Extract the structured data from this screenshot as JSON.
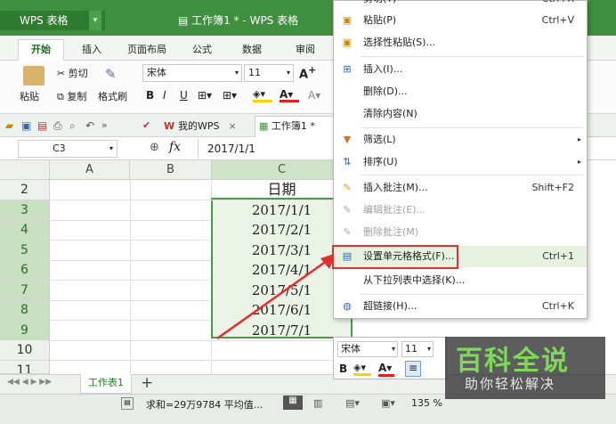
{
  "app": {
    "name": "WPS 表格",
    "window_title": "工作簿1 * - WPS 表格"
  },
  "ribbon_tabs": [
    "开始",
    "插入",
    "页面布局",
    "公式",
    "数据",
    "审阅"
  ],
  "clipboard": {
    "cut": "剪切",
    "paste": "粘贴",
    "copy": "复制",
    "format_painter": "格式刷"
  },
  "font": {
    "name": "宋体",
    "size": "11",
    "bold": "B",
    "italic": "I",
    "underline": "U"
  },
  "quickbar": {
    "tab_mywps": "我的WPS",
    "tab_book": "工作簿1 *"
  },
  "formula": {
    "cell_ref": "C3",
    "fx": "fx",
    "value": "2017/1/1"
  },
  "columns": [
    "A",
    "B",
    "C"
  ],
  "rows": [
    {
      "num": "2",
      "c": "日期"
    },
    {
      "num": "3",
      "c": "2017/1/1"
    },
    {
      "num": "4",
      "c": "2017/2/1"
    },
    {
      "num": "5",
      "c": "2017/3/1"
    },
    {
      "num": "6",
      "c": "2017/4/1"
    },
    {
      "num": "7",
      "c": "2017/5/1"
    },
    {
      "num": "8",
      "c": "2017/6/1"
    },
    {
      "num": "9",
      "c": "2017/7/1"
    },
    {
      "num": "10",
      "c": ""
    },
    {
      "num": "11",
      "c": ""
    }
  ],
  "sheet": {
    "name": "工作表1",
    "add": "+"
  },
  "status": {
    "summary": "求和=29万9784 平均值...",
    "zoom": "135 %"
  },
  "context_menu": {
    "cut": {
      "label": "剪切(T)",
      "shortcut": "Ctrl+X"
    },
    "paste": {
      "label": "粘贴(P)",
      "shortcut": "Ctrl+V"
    },
    "paste_special": {
      "label": "选择性粘贴(S)..."
    },
    "insert": {
      "label": "插入(I)..."
    },
    "delete": {
      "label": "删除(D)..."
    },
    "clear": {
      "label": "清除内容(N)"
    },
    "filter": {
      "label": "筛选(L)"
    },
    "sort": {
      "label": "排序(U)"
    },
    "insert_comment": {
      "label": "插入批注(M)...",
      "shortcut": "Shift+F2"
    },
    "edit_comment": {
      "label": "编辑批注(E)..."
    },
    "delete_comment": {
      "label": "删除批注(M)"
    },
    "format_cells": {
      "label": "设置单元格格式(F)...",
      "shortcut": "Ctrl+1"
    },
    "pick_from_list": {
      "label": "从下拉列表中选择(K)..."
    },
    "hyperlink": {
      "label": "超链接(H)...",
      "shortcut": "Ctrl+K"
    }
  },
  "mini_toolbar": {
    "font": "宋体",
    "size": "11"
  },
  "watermark": {
    "line1": "百科全说",
    "line2": "助你轻松解决"
  },
  "colors": {
    "accent": "#3f8f3f",
    "highlight_red": "#e03030",
    "selection": "#4a9a4a"
  }
}
